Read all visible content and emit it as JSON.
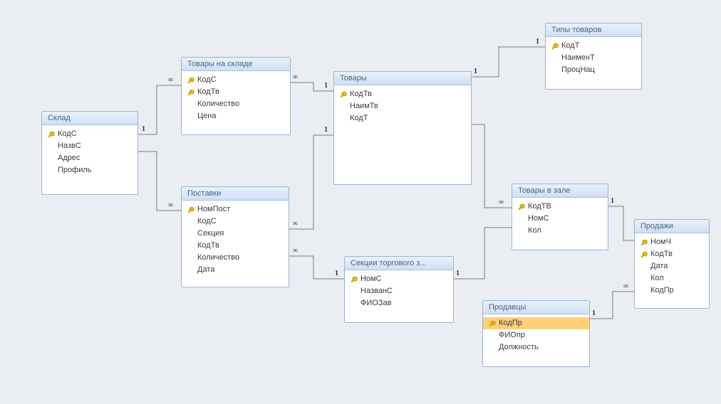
{
  "tables": [
    {
      "title": "Склад",
      "fields": [
        {
          "name": "КодС",
          "key": true
        },
        {
          "name": "НазвС"
        },
        {
          "name": "Адрес"
        },
        {
          "name": "Профиль"
        }
      ]
    },
    {
      "title": "Товары на складе",
      "fields": [
        {
          "name": "КодС",
          "key": true
        },
        {
          "name": "КодТв",
          "key": true
        },
        {
          "name": "Количество"
        },
        {
          "name": "Цена"
        }
      ]
    },
    {
      "title": "Товары",
      "fields": [
        {
          "name": "КодТв",
          "key": true
        },
        {
          "name": "НаимТв"
        },
        {
          "name": "КодТ"
        }
      ]
    },
    {
      "title": "Типы товаров",
      "fields": [
        {
          "name": "КодТ",
          "key": true
        },
        {
          "name": "НаименТ"
        },
        {
          "name": "ПроцНац"
        }
      ]
    },
    {
      "title": "Поставки",
      "fields": [
        {
          "name": "НомПост",
          "key": true
        },
        {
          "name": "КодС"
        },
        {
          "name": "Секция"
        },
        {
          "name": "КодТв"
        },
        {
          "name": "Количество"
        },
        {
          "name": "Дата"
        }
      ]
    },
    {
      "title": "Секции торгового з...",
      "fields": [
        {
          "name": "НомС",
          "key": true
        },
        {
          "name": "НазванС"
        },
        {
          "name": "ФИОЗав"
        }
      ]
    },
    {
      "title": "Товары в зале",
      "fields": [
        {
          "name": "КодТВ",
          "key": true
        },
        {
          "name": "НомС"
        },
        {
          "name": "Кол"
        }
      ]
    },
    {
      "title": "Продажи",
      "fields": [
        {
          "name": "НомЧ",
          "key": true
        },
        {
          "name": "КодТв",
          "key": true
        },
        {
          "name": "Дата"
        },
        {
          "name": "Кол"
        },
        {
          "name": "КодПр"
        }
      ]
    },
    {
      "title": "Продавцы",
      "fields": [
        {
          "name": "КодПр",
          "key": true,
          "selected": true
        },
        {
          "name": "ФИОпр"
        },
        {
          "name": "Должность"
        }
      ]
    }
  ]
}
